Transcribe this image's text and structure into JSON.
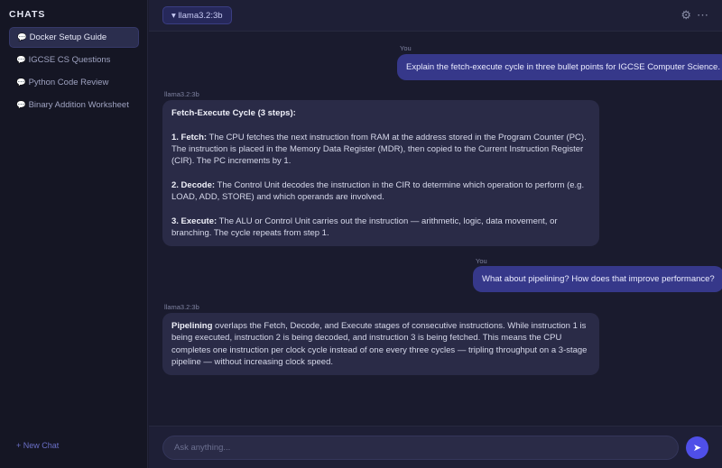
{
  "sidebar": {
    "title": "CHATS",
    "items": [
      {
        "icon": "💬",
        "label": "Docker Setup Guide",
        "active": true
      },
      {
        "icon": "💬",
        "label": "IGCSE CS Questions",
        "active": false
      },
      {
        "icon": "💬",
        "label": "Python Code Review",
        "active": false
      },
      {
        "icon": "💬",
        "label": "Binary Addition Worksheet",
        "active": false
      }
    ],
    "new_chat": "+ New Chat"
  },
  "header": {
    "model_label": "▾ llama3.2:3b",
    "icons": {
      "settings": "⚙",
      "more": "⋯"
    }
  },
  "messages": [
    {
      "role": "user",
      "sender": "You",
      "text": "Explain the fetch-execute cycle in three bullet points for IGCSE Computer Science."
    },
    {
      "role": "assistant",
      "sender": "llama3.2:3b",
      "title": "Fetch-Execute Cycle (3 steps):",
      "steps": [
        {
          "head": "1. Fetch:",
          "body": " The CPU fetches the next instruction from RAM at the address stored in the Program Counter (PC). The instruction is placed in the Memory Data Register (MDR), then copied to the Current Instruction Register (CIR). The PC increments by 1."
        },
        {
          "head": "2. Decode:",
          "body": " The Control Unit decodes the instruction in the CIR to determine which operation to perform (e.g. LOAD, ADD, STORE) and which operands are involved."
        },
        {
          "head": "3. Execute:",
          "body": " The ALU or Control Unit carries out the instruction — arithmetic, logic, data movement, or branching. The cycle repeats from step 1."
        }
      ]
    },
    {
      "role": "user",
      "sender": "You",
      "text": "What about pipelining? How does that improve performance?"
    },
    {
      "role": "assistant",
      "sender": "llama3.2:3b",
      "head": "Pipelining",
      "body": " overlaps the Fetch, Decode, and Execute stages of consecutive instructions. While instruction 1 is being executed, instruction 2 is being decoded, and instruction 3 is being fetched. This means the CPU completes one instruction per clock cycle instead of one every three cycles — tripling throughput on a 3-stage pipeline — without increasing clock speed."
    }
  ],
  "composer": {
    "placeholder": "Ask anything...",
    "send_icon": "➤"
  }
}
